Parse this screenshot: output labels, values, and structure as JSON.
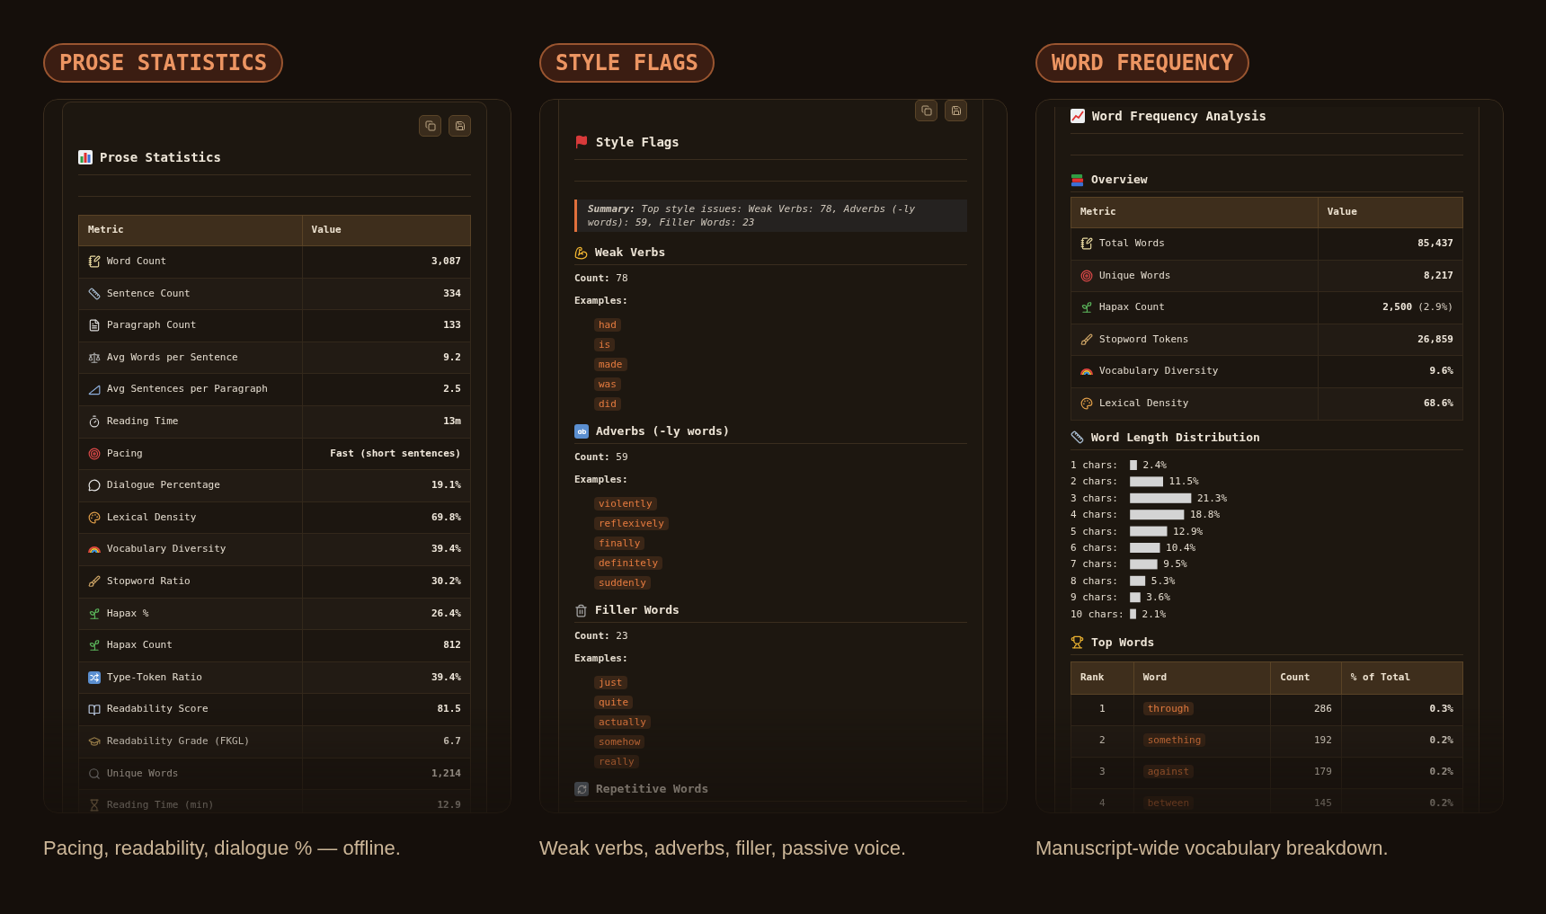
{
  "panels": [
    {
      "kind": "stats",
      "pill": "PROSE STATISTICS",
      "scrolled": false,
      "toolbar": true,
      "title": "Prose Statistics",
      "table": {
        "columns": [
          "Metric",
          "Value"
        ],
        "rows": [
          {
            "metric": "Word Count",
            "value": "3,087"
          },
          {
            "metric": "Sentence Count",
            "value": "334"
          },
          {
            "metric": "Paragraph Count",
            "value": "133"
          },
          {
            "metric": "Avg Words per Sentence",
            "value": "9.2"
          },
          {
            "metric": "Avg Sentences per Paragraph",
            "value": "2.5"
          },
          {
            "metric": "Reading Time",
            "value": "13m"
          },
          {
            "metric": "Pacing",
            "value": "Fast (short sentences)"
          },
          {
            "metric": "Dialogue Percentage",
            "value": "19.1%"
          },
          {
            "metric": "Lexical Density",
            "value": "69.8%"
          },
          {
            "metric": "Vocabulary Diversity",
            "value": "39.4%"
          },
          {
            "metric": "Stopword Ratio",
            "value": "30.2%"
          },
          {
            "metric": "Hapax %",
            "value": "26.4%"
          },
          {
            "metric": "Hapax Count",
            "value": "812"
          },
          {
            "metric": "Type-Token Ratio",
            "value": "39.4%"
          },
          {
            "metric": "Readability Score",
            "value": "81.5"
          },
          {
            "metric": "Readability Grade (FKGL)",
            "value": "6.7"
          },
          {
            "metric": "Unique Words",
            "value": "1,214"
          },
          {
            "metric": "Reading Time (min)",
            "value": "12.9"
          }
        ]
      },
      "caption": "Pacing, readability, dialogue % — offline."
    },
    {
      "kind": "flags",
      "pill": "STYLE FLAGS",
      "scrolled": true,
      "toolbar": true,
      "title": "Style Flags",
      "summary": "**Summary:** Top style issues: Weak Verbs: 78, Adverbs (-ly words): 59, Filler Words: 23",
      "sections": [
        {
          "heading": "Weak Verbs",
          "count": "**Count:** 78",
          "examples_label": "Examples:",
          "examples": [
            "had",
            "is",
            "made",
            "was",
            "did"
          ]
        },
        {
          "heading": "Adverbs (-ly words)",
          "count": "**Count:** 59",
          "examples_label": "Examples:",
          "examples": [
            "violently",
            "reflexively",
            "finally",
            "definitely",
            "suddenly"
          ]
        },
        {
          "heading": "Filler Words",
          "count": "**Count:** 23",
          "examples_label": "Examples:",
          "examples": [
            "just",
            "quite",
            "actually",
            "somehow",
            "really"
          ]
        },
        {
          "heading": "Repetitive Words"
        }
      ],
      "caption": "Weak verbs, adverbs, filler, passive voice."
    },
    {
      "kind": "frequency",
      "pill": "WORD FREQUENCY",
      "scrolled": true,
      "toolbar": false,
      "title": "Word Frequency Analysis",
      "overview": {
        "heading": "Overview",
        "columns": [
          "Metric",
          "Value"
        ],
        "rows": [
          {
            "metric": "Total Words",
            "value": "85,437"
          },
          {
            "metric": "Unique Words",
            "value": "8,217"
          },
          {
            "metric": "Hapax Count",
            "value": "2,500",
            "note": "(2.9%)"
          },
          {
            "metric": "Stopword Tokens",
            "value": "26,859"
          },
          {
            "metric": "Vocabulary Diversity",
            "value": "9.6%"
          },
          {
            "metric": "Lexical Density",
            "value": "68.6%"
          }
        ]
      },
      "distribution": {
        "heading": "Word Length Distribution",
        "label_separator": ":",
        "chart_data": {
          "type": "bar",
          "orientation": "horizontal",
          "categories": [
            "1 chars",
            "2 chars",
            "3 chars",
            "4 chars",
            "5 chars",
            "6 chars",
            "7 chars",
            "8 chars",
            "9 chars",
            "10 chars"
          ],
          "values": [
            2.4,
            11.5,
            21.3,
            18.8,
            12.9,
            10.4,
            9.5,
            5.3,
            3.6,
            2.1
          ],
          "value_labels": [
            "2.4%",
            "11.5%",
            "21.3%",
            "18.8%",
            "12.9%",
            "10.4%",
            "9.5%",
            "5.3%",
            "3.6%",
            "2.1%"
          ],
          "color": "#d4d4d4"
        }
      },
      "top_words": {
        "heading": "Top Words",
        "columns": [
          "Rank",
          "Word",
          "Count",
          "% of Total"
        ],
        "rows": [
          {
            "rank": "1",
            "word": "through",
            "count": "286",
            "share": "0.3%"
          },
          {
            "rank": "2",
            "word": "something",
            "count": "192",
            "share": "0.2%"
          },
          {
            "rank": "3",
            "word": "against",
            "count": "179",
            "share": "0.2%"
          },
          {
            "rank": "4",
            "word": "between",
            "count": "145",
            "share": "0.2%"
          }
        ]
      },
      "caption": "Manuscript-wide vocabulary breakdown."
    }
  ]
}
